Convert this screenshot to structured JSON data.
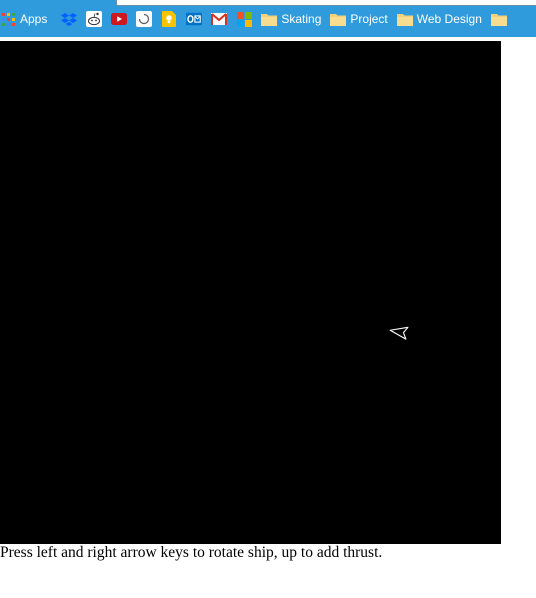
{
  "bookmarks_bar": {
    "items": [
      {
        "type": "apps",
        "label": "Apps",
        "icon": "apps-grid-icon"
      },
      {
        "type": "icon",
        "icon": "dropbox-icon"
      },
      {
        "type": "icon",
        "icon": "reddit-icon"
      },
      {
        "type": "icon",
        "icon": "youtube-icon"
      },
      {
        "type": "icon",
        "icon": "circle-app-icon"
      },
      {
        "type": "icon",
        "icon": "keep-bulb-icon"
      },
      {
        "type": "icon",
        "icon": "outlook-icon"
      },
      {
        "type": "icon",
        "icon": "gmail-icon"
      },
      {
        "type": "icon",
        "icon": "microsoft-icon"
      },
      {
        "type": "folder",
        "label": "Skating",
        "icon": "folder-icon"
      },
      {
        "type": "folder",
        "label": "Project",
        "icon": "folder-icon"
      },
      {
        "type": "folder",
        "label": "Web Design",
        "icon": "folder-icon"
      },
      {
        "type": "folder",
        "label": "",
        "icon": "folder-icon"
      }
    ]
  },
  "game": {
    "background_color": "#000000",
    "ship_color": "#ffffff",
    "ship_heading_deg": 200
  },
  "instructions": "Press left and right arrow keys to rotate ship, up to add thrust."
}
